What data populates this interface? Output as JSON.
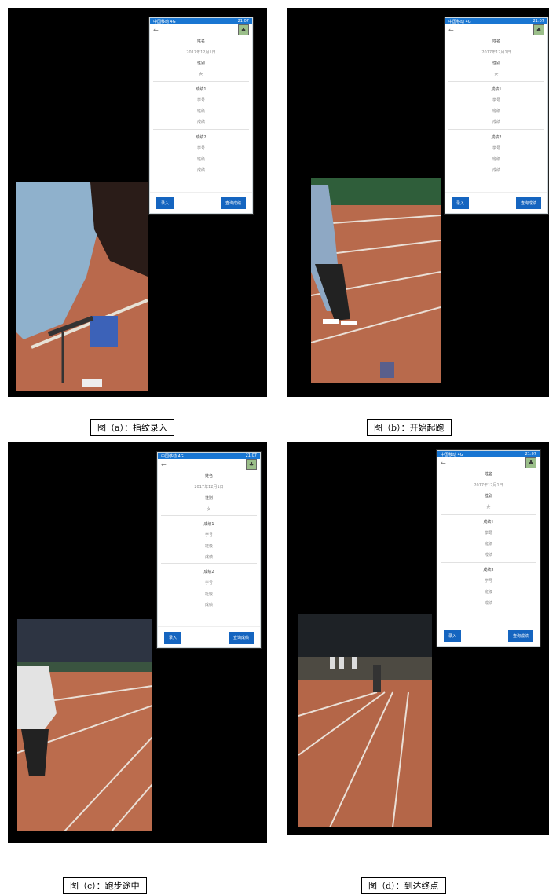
{
  "phone_ui": {
    "status_left": "中国移动 4G",
    "status_right": "21:07",
    "back_glyph": "←",
    "avatar_glyph": "♣",
    "rows": [
      "姓名",
      "2017年12月1日",
      "性别",
      "女",
      "成绩1",
      "学号",
      "班级",
      "成绩",
      "成绩2",
      "学号",
      "班级",
      "成绩"
    ],
    "enter_button": "录入",
    "query_button": "查询成绩"
  },
  "panels": [
    {
      "caption": "图（a）：指纹录入"
    },
    {
      "caption": "图（b）：开始起跑"
    },
    {
      "caption": "图（c）：跑步途中"
    },
    {
      "caption": "图（d）：到达终点"
    }
  ]
}
